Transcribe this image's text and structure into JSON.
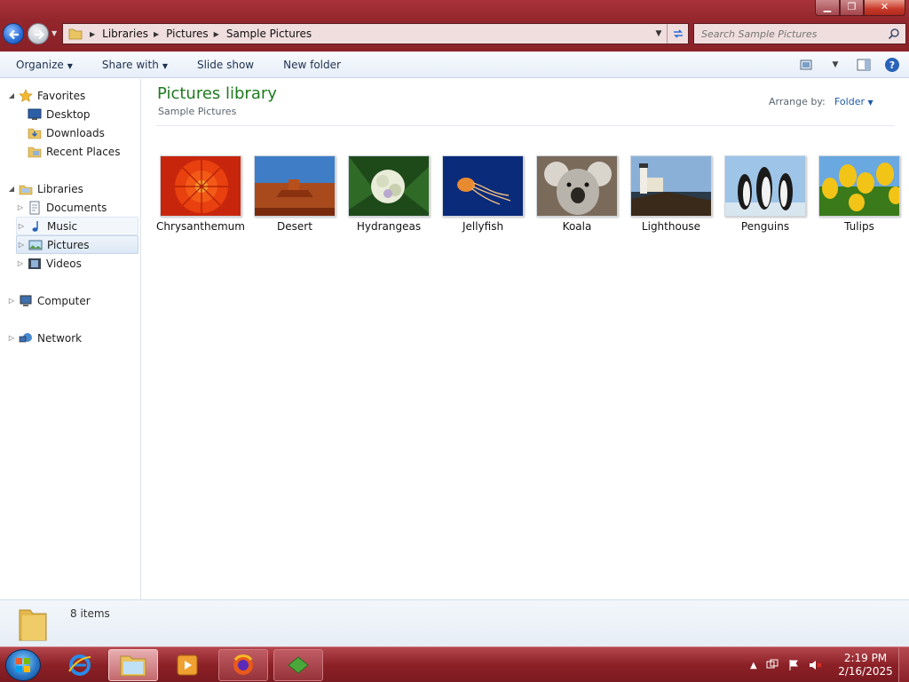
{
  "window": {
    "minimize": "▁",
    "maximize": "❐",
    "close": "✕"
  },
  "address": {
    "crumbs": [
      "Libraries",
      "Pictures",
      "Sample Pictures"
    ]
  },
  "search": {
    "placeholder": "Search Sample Pictures"
  },
  "toolbar": {
    "organize": "Organize",
    "share_with": "Share with",
    "slide_show": "Slide show",
    "new_folder": "New folder"
  },
  "nav": {
    "favorites": "Favorites",
    "desktop": "Desktop",
    "downloads": "Downloads",
    "recent_places": "Recent Places",
    "libraries": "Libraries",
    "documents": "Documents",
    "music": "Music",
    "pictures": "Pictures",
    "videos": "Videos",
    "computer": "Computer",
    "network": "Network"
  },
  "content": {
    "title": "Pictures library",
    "subtitle": "Sample Pictures",
    "arrange_label": "Arrange by:",
    "arrange_value": "Folder",
    "items": [
      {
        "label": "Chrysanthemum",
        "icon": "chrysanthemum-thumb"
      },
      {
        "label": "Desert",
        "icon": "desert-thumb"
      },
      {
        "label": "Hydrangeas",
        "icon": "hydrangeas-thumb"
      },
      {
        "label": "Jellyfish",
        "icon": "jellyfish-thumb"
      },
      {
        "label": "Koala",
        "icon": "koala-thumb"
      },
      {
        "label": "Lighthouse",
        "icon": "lighthouse-thumb"
      },
      {
        "label": "Penguins",
        "icon": "penguins-thumb"
      },
      {
        "label": "Tulips",
        "icon": "tulips-thumb"
      }
    ]
  },
  "details": {
    "count": "8 items"
  },
  "taskbar": {
    "time": "2:19 PM",
    "date": "2/16/2025"
  },
  "colors": {
    "titlebar": "#93262c",
    "library_title": "#1e7a1e",
    "taskbar": "#8c2127"
  }
}
